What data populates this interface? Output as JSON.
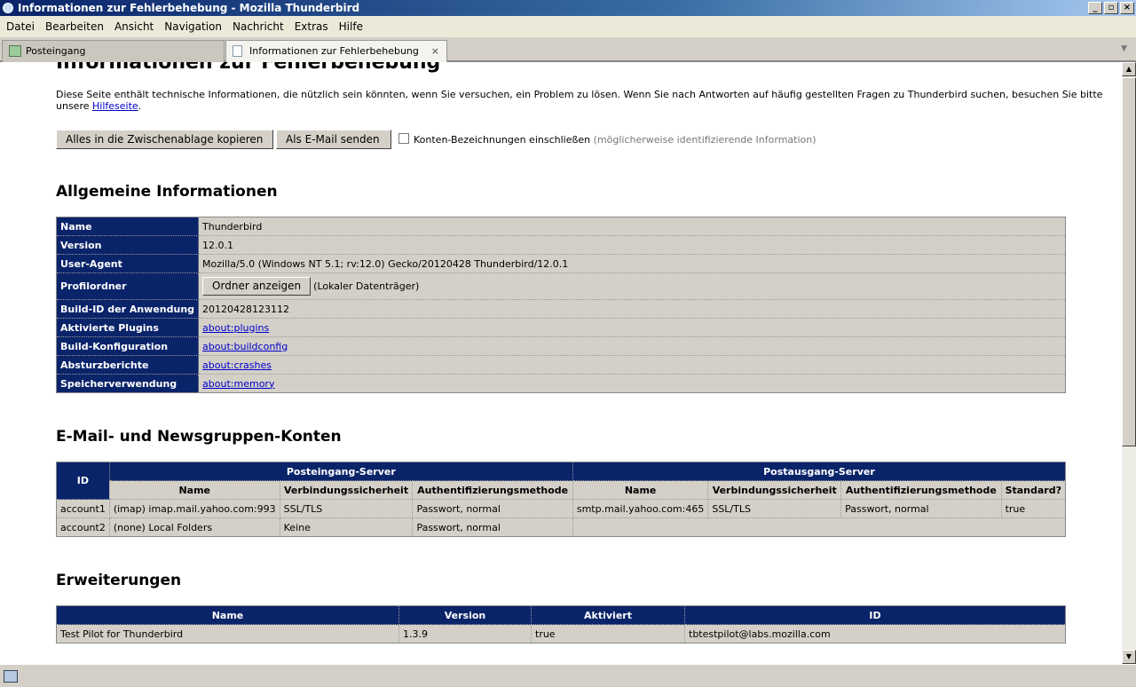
{
  "window": {
    "title": "Informationen zur Fehlerbehebung - Mozilla Thunderbird",
    "min": "_",
    "max": "▫",
    "close": "×"
  },
  "menu": [
    "Datei",
    "Bearbeiten",
    "Ansicht",
    "Navigation",
    "Nachricht",
    "Extras",
    "Hilfe"
  ],
  "tabs": [
    {
      "label": "Posteingang"
    },
    {
      "label": "Informationen zur Fehlerbehebung",
      "close": "×"
    }
  ],
  "page": {
    "title": "Informationen zur Fehlerbehebung",
    "intro": "Diese Seite enthält technische Informationen, die nützlich sein könnten, wenn Sie versuchen, ein Problem zu lösen. Wenn Sie nach Antworten auf häufig gestellten Fragen zu Thunderbird suchen, besuchen Sie bitte unsere ",
    "intro_link": "Hilfeseite",
    "intro_end": ".",
    "copy_button": "Alles in die Zwischenablage kopieren",
    "email_button": "Als E-Mail senden",
    "checkbox_label": "Konten-Bezeichnungen einschließen",
    "checkbox_hint": "(möglicherweise identifizierende Information)",
    "checkbox_checked": false
  },
  "general": {
    "heading": "Allgemeine Informationen",
    "rows": [
      {
        "label": "Name",
        "value": "Thunderbird"
      },
      {
        "label": "Version",
        "value": "12.0.1"
      },
      {
        "label": "User-Agent",
        "value": "Mozilla/5.0 (Windows NT 5.1; rv:12.0) Gecko/20120428 Thunderbird/12.0.1"
      },
      {
        "label": "Profilordner",
        "button": "Ordner anzeigen",
        "value": "(Lokaler Datenträger)"
      },
      {
        "label": "Build-ID der Anwendung",
        "value": "20120428123112"
      },
      {
        "label": "Aktivierte Plugins",
        "link": "about:plugins"
      },
      {
        "label": "Build-Konfiguration",
        "link": "about:buildconfig"
      },
      {
        "label": "Absturzberichte",
        "link": "about:crashes"
      },
      {
        "label": "Speicherverwendung",
        "link": "about:memory"
      }
    ]
  },
  "accounts": {
    "heading": "E-Mail- und Newsgruppen-Konten",
    "id_header": "ID",
    "incoming": "Posteingang-Server",
    "outgoing": "Postausgang-Server",
    "in_cols": [
      "Name",
      "Verbindungssicherheit",
      "Authentifizierungsmethode"
    ],
    "out_cols": [
      "Name",
      "Verbindungssicherheit",
      "Authentifizierungsmethode",
      "Standard?"
    ],
    "rows": [
      {
        "id": "account1",
        "in": [
          "(imap) imap.mail.yahoo.com:993",
          "SSL/TLS",
          "Passwort, normal"
        ],
        "out": [
          "smtp.mail.yahoo.com:465",
          "SSL/TLS",
          "Passwort, normal",
          "true"
        ]
      },
      {
        "id": "account2",
        "in": [
          "(none) Local Folders",
          "Keine",
          "Passwort, normal"
        ]
      }
    ]
  },
  "extensions": {
    "heading": "Erweiterungen",
    "cols": [
      "Name",
      "Version",
      "Aktiviert",
      "ID"
    ],
    "rows": [
      [
        "Test Pilot for Thunderbird",
        "1.3.9",
        "true",
        "tbtestpilot@labs.mozilla.com"
      ]
    ]
  }
}
